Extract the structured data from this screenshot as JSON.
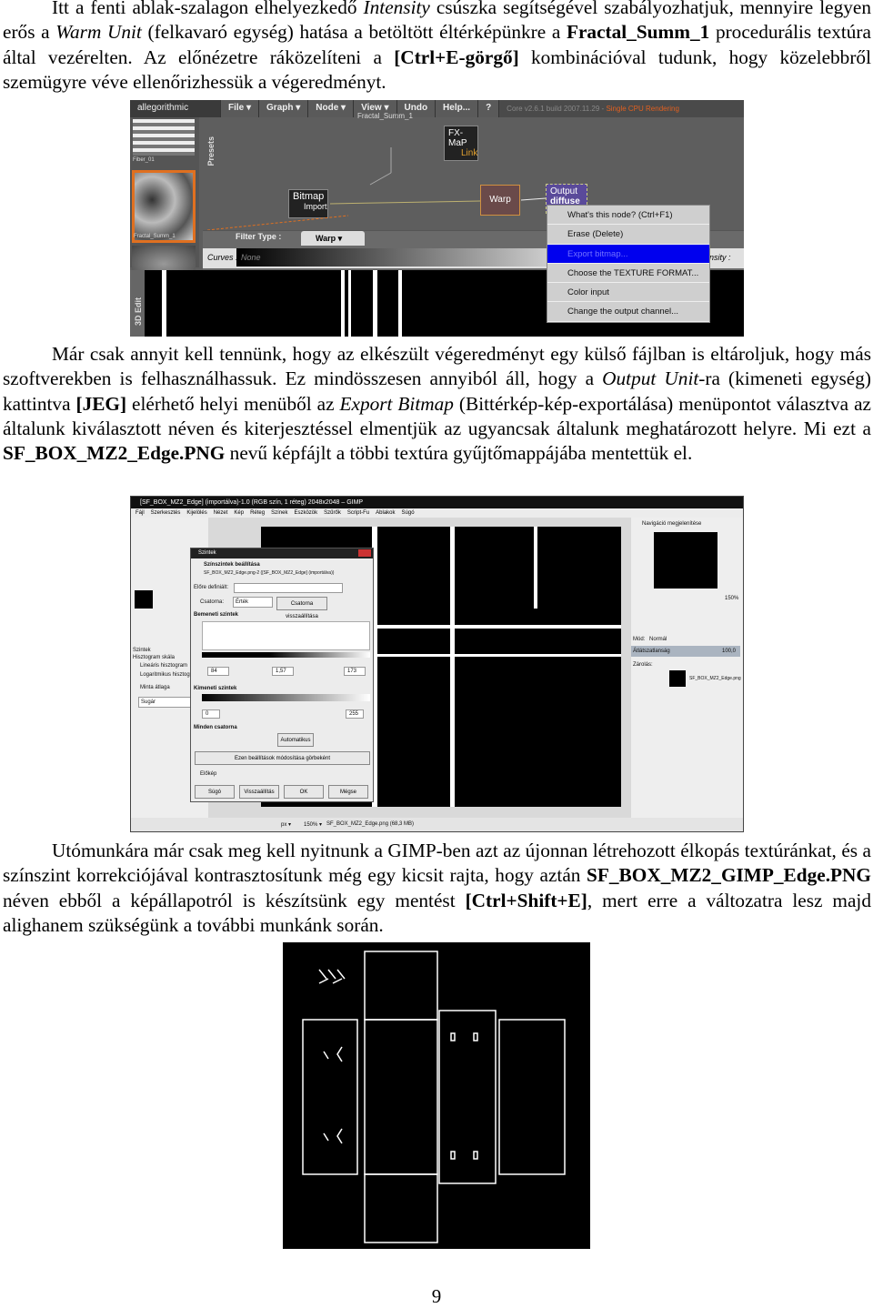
{
  "p1": [
    "Itt a fenti ablak-szalagon elhelyezkedő ",
    "Intensity",
    " csúszka segítségével szabályozhatjuk, mennyire legyen erős a ",
    "Warm Unit",
    " (felkavaró egység) hatása a betöltött éltérképünkre a ",
    "Fractal_Summ_1",
    " procedurális textúra által vezérelten. Az előnézetre ráközelíteni a ",
    "[Ctrl+E-görgő]",
    " kombinációval tudunk, hogy közelebbről szemügyre véve ellenőrizhessük a végeredményt."
  ],
  "p2": [
    "Már csak annyit kell tennünk, hogy az elkészült végeredményt egy külső fájlban is eltároljuk, hogy más szoftverekben is felhasználhassuk. Ez mindösszesen annyiból áll, hogy a ",
    "Output Unit",
    "-ra (kimeneti egység) kattintva ",
    "[JEG]",
    " elérhető helyi menüből az ",
    "Export Bitmap",
    " (Bittérkép-kép-exportálása) menüpontot választva az általunk kiválasztott néven és kiterjesztéssel elmentjük az ugyancsak általunk meghatározott helyre. Mi ezt a ",
    "SF_BOX_MZ2_Edge.PNG",
    " nevű képfájlt a többi textúra gyűjtőmappájába mentettük el."
  ],
  "p3": [
    "Utómunkára már csak meg kell nyitnunk a GIMP-ben azt az újonnan létrehozott élkopás textúránkat, és a színszint korrekciójával kontrasztosítunk még egy kicsit rajta, hogy aztán ",
    "SF_BOX_MZ2_GIMP_Edge.PNG",
    " néven ebből a képállapotról is készítsünk egy mentést ",
    "[Ctrl+Shift+E]",
    ", mert erre a változatra lesz majd alighanem szükségünk a további munkánk során."
  ],
  "shot1": {
    "logo": "allegorithmic",
    "menu": [
      "File ▾",
      "Graph ▾",
      "Node ▾",
      "View ▾",
      "Undo",
      "Help...",
      "?"
    ],
    "version": "Core v2.6.1 build 2007.11.29 - ",
    "rendering": "Single CPU Rendering",
    "presets": "Presets",
    "fiber": "Fiber_01",
    "fractal": "Fractal_Summ_1",
    "edit3d": "3D Edit",
    "nodes": {
      "fxmap": "FX-MaP",
      "link": "Link",
      "bitmap": "Bitmap",
      "import": "Import",
      "warp": "Warp",
      "output": "Output",
      "diffuse": "diffuse",
      "top": "Fractal_Summ_1"
    },
    "filter_label": "Filter Type :",
    "filter_value": "Warp ▾",
    "curves_label": "Curves :",
    "curves_value": "None",
    "intensity": "nsity :",
    "context_menu": [
      "What's this node? (Ctrl+F1)",
      "Erase (Delete)",
      "Export bitmap...",
      "Choose the TEXTURE FORMAT...",
      "Color input",
      "Change the output channel..."
    ],
    "highlight_color": "#0000ee"
  },
  "shot2": {
    "title": "[SF_BOX_MZ2_Edge] (importálva)-1.0 (RGB szín, 1 réteg) 2048x2048 – GIMP",
    "menu": [
      "Fájl",
      "Szerkesztés",
      "Kijelölés",
      "Nézet",
      "Kép",
      "Réteg",
      "Színek",
      "Eszközök",
      "Szűrők",
      "Script-Fu",
      "Ablakok",
      "Súgó"
    ],
    "left": {
      "title": "Szintek",
      "scale": "Hisztogram skála",
      "linear": "Lineáris hisztogram",
      "log": "Logaritmikus hisztogram",
      "sample": "Minta átlaga",
      "radius": "Sugár"
    },
    "dialog": {
      "title": "Szintek",
      "heading": "Színszintek beállítása",
      "subtitle": "SF_BOX_MZ2_Edge.png-2 ([SF_BOX_MZ2_Edge] (importálva))",
      "preset": "Előre definiált:",
      "channel_label": "Csatorna:",
      "channel": "Érték",
      "reset_channel": "Csatorna visszaállítása",
      "input": "Bemeneti szintek",
      "in_low": "84",
      "gamma": "1,57",
      "in_high": "173",
      "output": "Kimeneti szintek",
      "out_low": "0",
      "out_high": "255",
      "all": "Minden csatorna",
      "auto": "Automatikus",
      "curves": "Ezen beállítások módosítása görbeként",
      "preview": "Előkép",
      "buttons": [
        "Súgó",
        "Visszaállítás",
        "OK",
        "Mégse"
      ]
    },
    "right": {
      "nav": "Navigáció megjelenítése",
      "zoom": "150%",
      "mode_label": "Mód:",
      "mode": "Normál",
      "opacity_label": "Átlátszatlanság",
      "opacity": "100,0",
      "lock": "Zárolás:",
      "layer": "SF_BOX_MZ2_Edge.png"
    },
    "status": {
      "unit": "px ▾",
      "zoom": "150% ▾",
      "file": "SF_BOX_MZ2_Edge.png (68,3 MB)"
    }
  },
  "page_number": "9"
}
